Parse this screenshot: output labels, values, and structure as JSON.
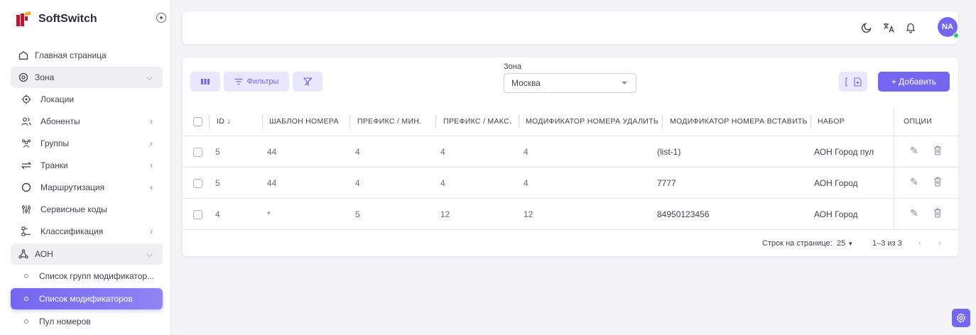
{
  "brand": {
    "name": "SoftSwitch",
    "colors": [
      "#c8102e",
      "#f5a623"
    ]
  },
  "sidebar": {
    "items": [
      {
        "label": "Главная страница",
        "icon": "home-icon"
      },
      {
        "label": "Зона",
        "icon": "location-pin-icon",
        "state": "expanded"
      },
      {
        "label": "Локации",
        "icon": "target-icon"
      },
      {
        "label": "Абоненты",
        "icon": "users-icon"
      },
      {
        "label": "Группы",
        "icon": "group-icon"
      },
      {
        "label": "Транки",
        "icon": "arrows-icon"
      },
      {
        "label": "Маршрутизация",
        "icon": "circle-icon"
      },
      {
        "label": "Сервисные коды",
        "icon": "sliders-icon"
      },
      {
        "label": "Классификация",
        "icon": "hierarchy-icon"
      },
      {
        "label": "АОН",
        "icon": "network-icon",
        "state": "expanded"
      },
      {
        "label": "Список групп модификатор..."
      },
      {
        "label": "Список модификаторов",
        "state": "active"
      },
      {
        "label": "Пул номеров"
      }
    ]
  },
  "topbar": {
    "icons": [
      "theme-toggle-icon",
      "translate-icon",
      "bell-icon"
    ],
    "avatar_initials": "NA",
    "status_color": "#28c76f"
  },
  "toolbar": {
    "filters_label": "Фильтры",
    "zone_label": "Зона",
    "zone_value": "Москва",
    "add_label": "+ Добавить"
  },
  "table": {
    "columns": [
      "ID",
      "ШАБЛОН НОМЕРА",
      "ПРЕФИКС / МИН.",
      "ПРЕФИКС / МАКС.",
      "МОДИФИКАТОР НОМЕРА УДАЛИТЬ",
      "МОДИФИКАТОР НОМЕРА ВСТАВИТЬ",
      "НАБОР",
      "ОПЦИИ"
    ],
    "rows": [
      [
        "5",
        "44",
        "4",
        "4",
        "4",
        "(list-1)",
        "АОН Город пул"
      ],
      [
        "5",
        "44",
        "4",
        "4",
        "4",
        "7777",
        "АОН Город"
      ],
      [
        "4",
        "*",
        "5",
        "12",
        "12",
        "84950123456",
        "АОН Город"
      ]
    ]
  },
  "pagination": {
    "rows_per_page_label": "Строк на странице:",
    "rows_per_page_value": "25",
    "range": "1–3 из 3"
  },
  "colors": {
    "primary": "#7367f0",
    "primary_light": "#e9e7fd"
  }
}
